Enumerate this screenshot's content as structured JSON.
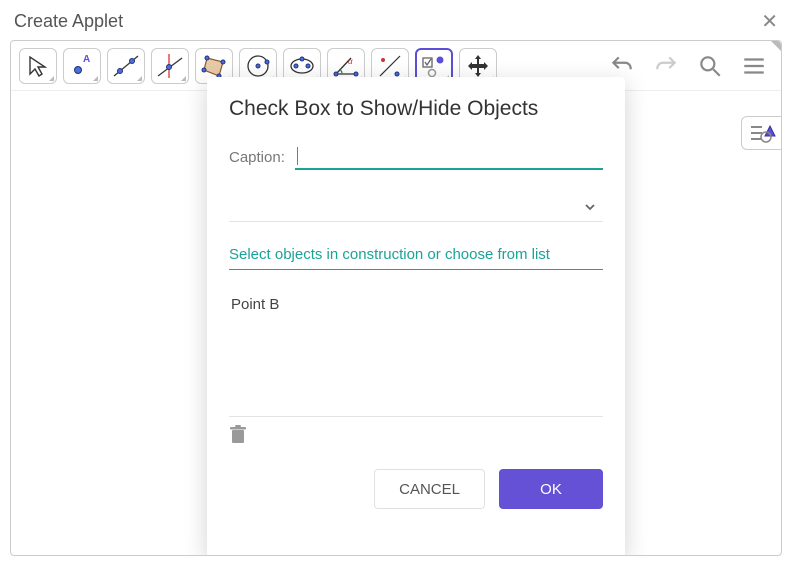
{
  "window": {
    "title": "Create Applet"
  },
  "toolbar": {
    "tools": [
      "move-tool",
      "point-tool",
      "line-tool",
      "perpendicular-tool",
      "polygon-tool",
      "circle-tool",
      "ellipse-tool",
      "angle-tool",
      "reflect-tool",
      "slider-tool",
      "move-view-tool"
    ],
    "selected_index": 9
  },
  "dialog": {
    "title": "Check Box to Show/Hide Objects",
    "caption_label": "Caption:",
    "caption_value": "",
    "select_hint": "Select objects in construction or choose from list",
    "selected_objects": [
      "Point B"
    ],
    "cancel_label": "CANCEL",
    "ok_label": "OK"
  }
}
